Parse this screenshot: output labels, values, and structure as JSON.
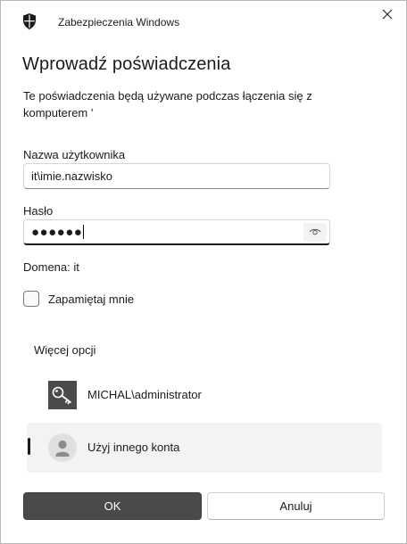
{
  "window": {
    "title": "Zabezpieczenia Windows",
    "app_icon": "shield-icon",
    "close_icon": "close-icon"
  },
  "dialog": {
    "heading": "Wprowadź poświadczenia",
    "description": "Te poświadczenia będą używane podczas łączenia się z komputerem '"
  },
  "username": {
    "label": "Nazwa użytkownika",
    "value": "it\\imie.nazwisko"
  },
  "password": {
    "label": "Hasło",
    "masked_value": "●●●●●●",
    "reveal_icon": "eye-icon"
  },
  "domain_text": "Domena: it",
  "remember": {
    "label": "Zapamiętaj mnie",
    "checked": false
  },
  "more_options": {
    "label": "Więcej opcji",
    "accounts": [
      {
        "label": "MICHAL\\administrator",
        "icon": "key-icon",
        "selected": false
      },
      {
        "label": "Użyj innego konta",
        "icon": "user-avatar-icon",
        "selected": true
      }
    ]
  },
  "buttons": {
    "ok": "OK",
    "cancel": "Anuluj"
  },
  "colors": {
    "primary_button": "#4c4a48",
    "selected_item_bg": "#f3f3f3"
  }
}
